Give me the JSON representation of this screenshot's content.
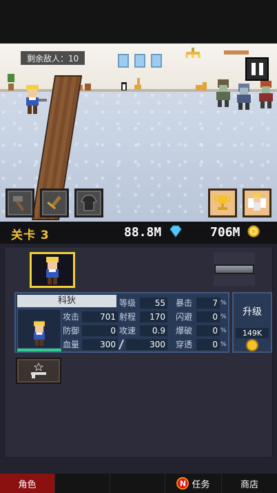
{
  "scene": {
    "enemies_remaining": "剩余敌人：10",
    "pause_icon": "pause-icon",
    "skills": [
      "hammer-icon",
      "sword-icon",
      "armor-icon"
    ],
    "actions": [
      "trophy-icon",
      "angel-icon"
    ]
  },
  "stage_bar": {
    "stage": "关卡 3",
    "gems": "88.8M",
    "gold": "706M"
  },
  "hero": {
    "name": "科狄",
    "hp_fill": 1.0,
    "stats": {
      "attack_label": "攻击",
      "attack": "701",
      "defense_label": "防御",
      "defense": "0",
      "hp_label": "血量",
      "hp": "300",
      "hp_max": "300",
      "level_label": "等级",
      "level": "55",
      "range_label": "射程",
      "range": "170",
      "speed_label": "攻速",
      "speed": "0.9",
      "crit_label": "暴击",
      "crit": "7",
      "dodge_label": "闪避",
      "dodge": "0",
      "burst_label": "爆破",
      "burst": "0",
      "pierce_label": "穿透",
      "pierce": "0",
      "pct": "%"
    }
  },
  "upgrade": {
    "label": "升级",
    "cost": "149K"
  },
  "nav": {
    "character": "角色",
    "tasks": "任务",
    "badge": "N",
    "shop": "商店"
  },
  "colors": {
    "accent_gold": "#f2c233",
    "selected_tab": "#8b1010",
    "stat_panel": "#283a55"
  }
}
